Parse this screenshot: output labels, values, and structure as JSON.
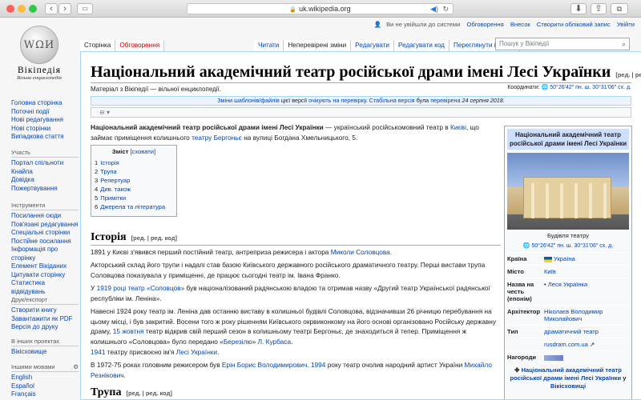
{
  "browser": {
    "url": "uk.wikipedia.org",
    "reload_icon": "reload-icon",
    "speaker_icon": "speaker-icon"
  },
  "sidebar": {
    "logo_wordmark": "Вікіпедія",
    "logo_tagline": "Вільна енциклопедія",
    "main_nav": [
      "Головна сторінка",
      "Поточні події",
      "Нові редагування",
      "Нові сторінки",
      "Випадкова стаття"
    ],
    "participation": {
      "heading": "Участь",
      "items": [
        "Портал спільноти",
        "Кнайпа",
        "Довідка",
        "Пожертвування"
      ]
    },
    "tools": {
      "heading": "Інструменти",
      "items": [
        "Посилання сюди",
        "Пов'язані редагування",
        "Спеціальні сторінки",
        "Постійне посилання",
        "Інформація про сторінку",
        "Елемент Вікіданих",
        "Цитувати сторінку",
        "Статистика відвідувань"
      ]
    },
    "print": {
      "heading": "Друк/експорт",
      "items": [
        "Створити книгу",
        "Завантажити як PDF",
        "Версія до друку"
      ]
    },
    "projects": {
      "heading": "В інших проектах",
      "items": [
        "Вікісховище"
      ]
    },
    "languages": {
      "heading": "Іншими мовами",
      "items": [
        "English",
        "Español",
        "Français"
      ]
    }
  },
  "header": {
    "personal": {
      "not_logged": "Ви не увійшли до системи",
      "links": [
        "Обговорення",
        "Внесок",
        "Створити обліковий запис",
        "Увійти"
      ]
    },
    "tabs_left": [
      "Сторінка",
      "Обговорення"
    ],
    "tabs_right": [
      "Читати",
      "Неперевірені зміни",
      "Редагувати",
      "Редагувати код",
      "Переглянути історію"
    ],
    "search_placeholder": "Пошук у Вікіпедії"
  },
  "article": {
    "title": "Національний академічний театр російської драми імені Лесі Українки",
    "title_edit": "[ред. | ред. код]",
    "site_sub": "Матеріал з Вікіпедії — вільної енциклопедії.",
    "coords_label": "Координати:",
    "coords_value": "50°26′42″ пн. ш. 30°31′06″ сх. д.",
    "flagged": {
      "link1": "Зміни шаблонів/файлів",
      "text1": "цієї версії",
      "link2": "очікують на перевірку",
      "text2": ". ",
      "link3": "Стабільна версія",
      "text3": "була",
      "link4": "перевірена",
      "date": "24 серпня 2018."
    },
    "lead": {
      "bold": "Національний академічний театр російської драми імені Лесі Українки",
      "t1": " — український російськомовний театр в ",
      "l1": "Києві",
      "t2": ", що займає приміщення колишнього ",
      "l2": "театру Бергоньє",
      "t3": " на вулиці Богдана Хмельницького, 5."
    },
    "toc": {
      "title": "Зміст",
      "toggle": "[сховати]",
      "items": [
        {
          "n": "1",
          "label": "Історія"
        },
        {
          "n": "2",
          "label": "Трупа"
        },
        {
          "n": "3",
          "label": "Репертуар"
        },
        {
          "n": "4",
          "label": "Див. також"
        },
        {
          "n": "5",
          "label": "Примітки"
        },
        {
          "n": "6",
          "label": "Джерела та література"
        }
      ]
    },
    "history": {
      "heading": "Історія",
      "edit": "[ред. | ред. код]",
      "p1": {
        "t1": "1891 у Києві з'явився перший постійний театр, антреприза режисера і актора ",
        "l1": "Миколи Соловцова",
        "t2": "."
      },
      "p2": "Акторський склад його трупи і надалі став базою Київського державного російського драматичного театру. Перші вистави трупа Соловцова показувала у приміщенні, де працює сьогодні театр ім. Івана Франко.",
      "p3": {
        "t1": "У ",
        "l1": "1919 році",
        "t2": " ",
        "l2": "театр «Соловцов»",
        "t3": " був націоналізований радянською владою та отримав назву «Другий театр Української радянської республіки ім. Леніна»."
      },
      "p4": {
        "t1": "Навесні 1924 року театр ім. Леніна дав останню виставу в колишньої будівлі Соловцова, відзначивши 26 річницю перебування на цьому місці, і був закритий. Восени того ж року рішенням Київського окрвиконкому на його основі організовано Російську державну драму, ",
        "l1": "15 жовтня",
        "t2": " театр відкрив свій перший сезон в колишньому театрі Бергоньє, де знаходиться й тепер. Приміщення ж колишнього «Соловцова» було передано «",
        "l2": "Березілю",
        "t3": "» ",
        "l3": "Л. Курбаса",
        "t4": "."
      },
      "p5": {
        "l1": "1941",
        "t1": " театру присвоєно ім'я ",
        "l2": "Лесі Українки",
        "t2": "."
      },
      "p6": {
        "t1": "В 1972-75 роках головним режисером був ",
        "l1": "Ерін Борис Володимирович",
        "t2": ". ",
        "l2": "1994",
        "t3": " року театр очолив народний артист України ",
        "l3": "Михайло Резнікович",
        "t4": "."
      }
    },
    "troupe": {
      "heading": "Трупа",
      "edit": "[ред. | ред. код]"
    }
  },
  "infobox": {
    "title": "Національний академічний театр російської драми імені Лесі Українки",
    "caption": "Будівля театру",
    "coords": "50°26′42″ пн. ш. 30°31′06″ сх. д.",
    "rows": [
      {
        "key": "Країна",
        "value": "Україна",
        "flag": true
      },
      {
        "key": "Місто",
        "value": "Київ"
      },
      {
        "key": "Назва на честь (епонім)",
        "value": "Леся Українка",
        "bullet": true
      },
      {
        "key": "Архітектор",
        "value": "Ніколаєв Володимир Миколайович"
      },
      {
        "key": "Тип",
        "value": "драматичний театр"
      },
      {
        "key": "",
        "value": "rusdram.com.ua"
      },
      {
        "key": "Нагороди",
        "value": ""
      }
    ],
    "footer_link": "Національний академічний театр російської драми імені Лесі Українки",
    "footer_text": "у",
    "footer_link2": "Вікісховищі"
  }
}
